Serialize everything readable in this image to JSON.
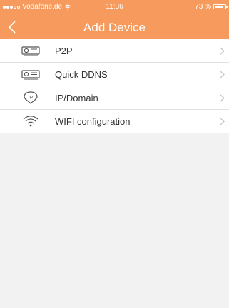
{
  "status_bar": {
    "carrier": "Vodafone.de",
    "time": "11:36",
    "battery": "73 %",
    "battery_level": 0.73
  },
  "header": {
    "title": "Add Device",
    "background_color": "#f79a5d"
  },
  "menu": {
    "items": [
      {
        "label": "P2P",
        "icon": "device-icon"
      },
      {
        "label": "Quick DDNS",
        "icon": "device-icon"
      },
      {
        "label": "IP/Domain",
        "icon": "ip-icon"
      },
      {
        "label": "WIFI configuration",
        "icon": "wifi-icon"
      }
    ]
  }
}
